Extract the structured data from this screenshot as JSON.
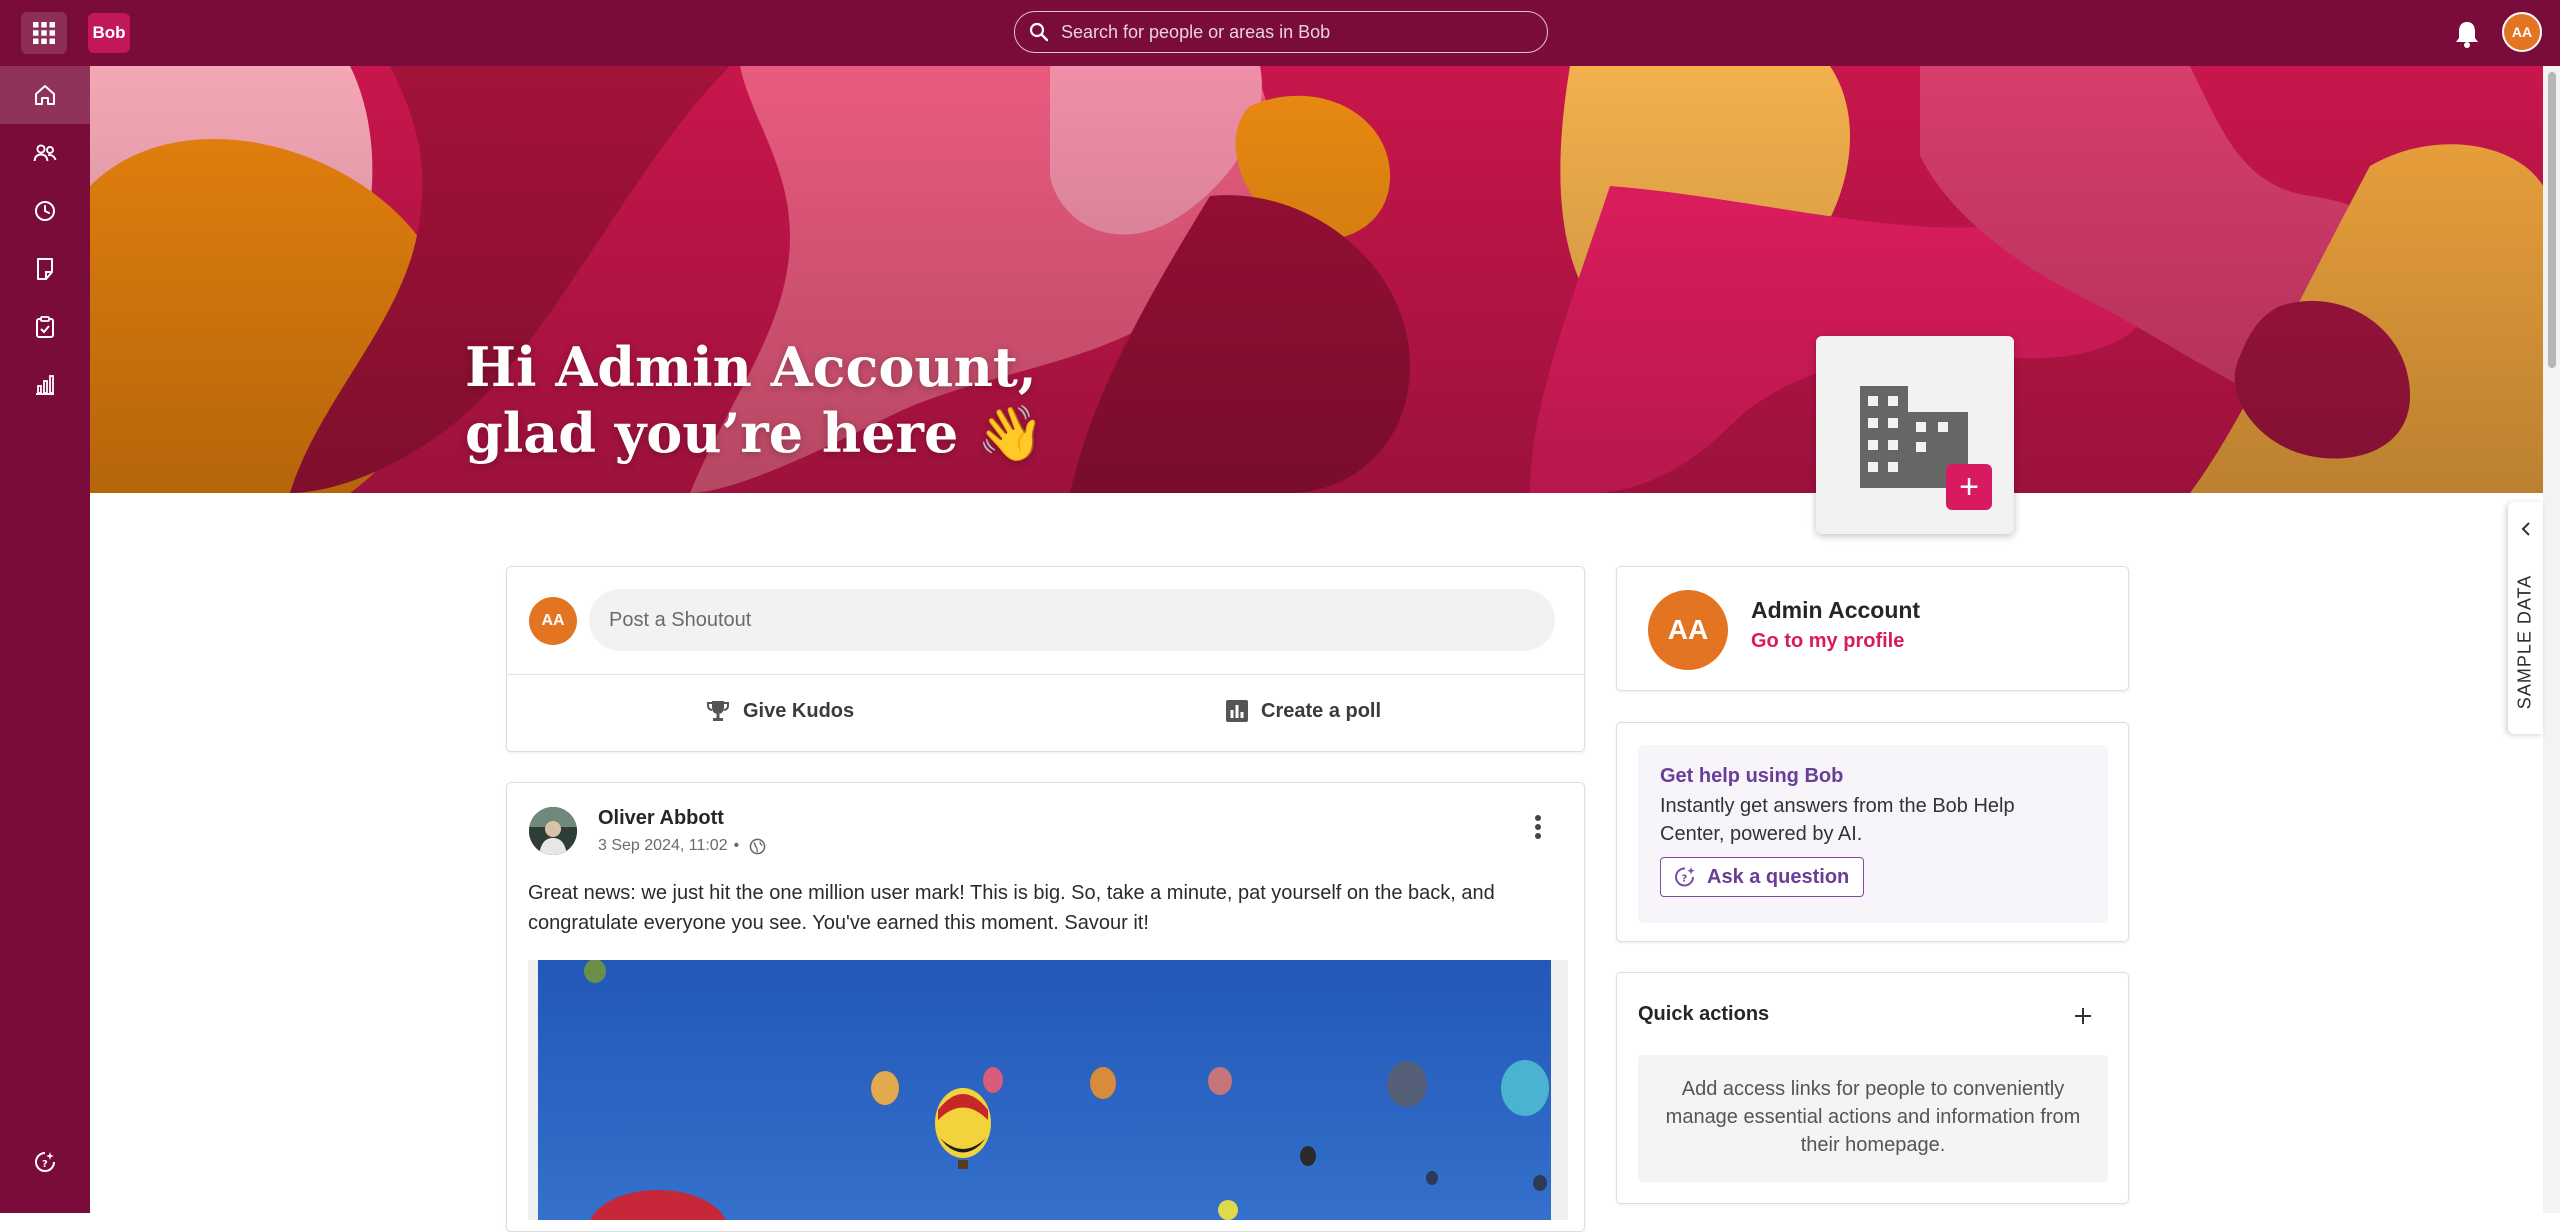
{
  "app": {
    "logo_text": "Bob"
  },
  "topbar": {
    "search_placeholder": "Search for people or areas in Bob",
    "user_initials": "AA"
  },
  "sidebar": {
    "items": [
      {
        "icon": "home-icon",
        "active": true
      },
      {
        "icon": "people-icon",
        "active": false
      },
      {
        "icon": "clock-icon",
        "active": false
      },
      {
        "icon": "document-icon",
        "active": false
      },
      {
        "icon": "clipboard-icon",
        "active": false
      },
      {
        "icon": "analytics-icon",
        "active": false
      },
      {
        "icon": "help-assistant-icon",
        "active": false
      }
    ]
  },
  "banner": {
    "greeting_line1": "Hi Admin Account,",
    "greeting_line2": "glad you’re here 👋"
  },
  "shoutout": {
    "avatar_initials": "AA",
    "placeholder": "Post a Shoutout",
    "kudos_label": "Give Kudos",
    "poll_label": "Create a poll"
  },
  "feed": [
    {
      "author": "Oliver Abbott",
      "timestamp": "3 Sep 2024, 11:02",
      "separator": "•",
      "visibility_icon": "globe-icon",
      "text": "Great news: we just hit the one million user mark! This is big. So, take a minute, pat yourself on the back, and congratulate everyone you see. You've earned this moment. Savour it!",
      "image": "hot-air-balloons-photo"
    }
  ],
  "profile_card": {
    "initials": "AA",
    "name": "Admin Account",
    "link": "Go to my profile"
  },
  "help_card": {
    "title": "Get help using Bob",
    "description": "Instantly get answers from the Bob Help Center, powered by AI.",
    "button": "Ask a question"
  },
  "quick_actions": {
    "title": "Quick actions",
    "empty_text": "Add access links for people to conveniently manage essential actions and information from their homepage."
  },
  "sample_tab": {
    "label": "SAMPLE DATA"
  },
  "colors": {
    "brand": "#7a0c3c",
    "accent": "#d81b60",
    "avatar": "#e37522",
    "help_purple": "#6a3d98"
  }
}
